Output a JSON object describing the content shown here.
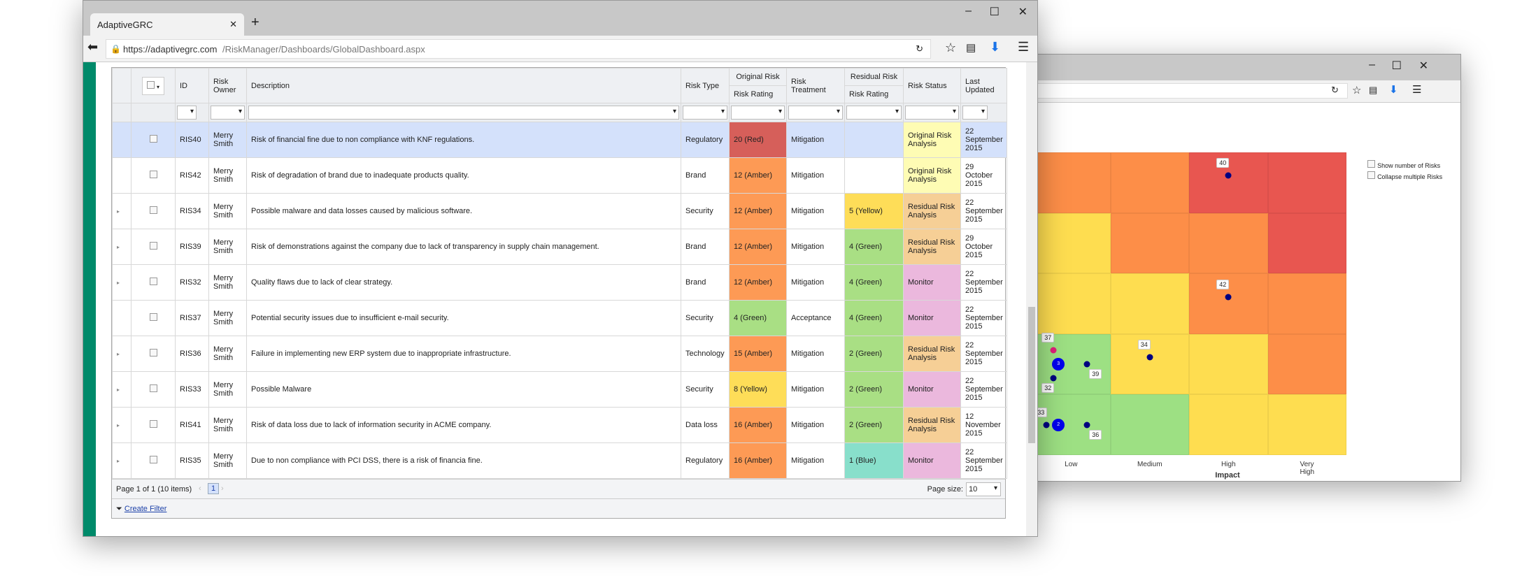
{
  "browser": {
    "tab_title": "AdaptiveGRC",
    "url_host": "https://adaptivegrc.com",
    "url_path": "/RiskManager/Dashboards/GlobalDashboard.aspx"
  },
  "table": {
    "headers": {
      "id": "ID",
      "owner": "Risk Owner",
      "description": "Description",
      "type": "Risk Type",
      "original_group": "Original Risk",
      "original_rating": "Risk Rating",
      "treatment": "Risk Treatment",
      "residual_group": "Residual Risk",
      "residual_rating": "Risk Rating",
      "status": "Risk Status",
      "updated": "Last Updated"
    },
    "rows": [
      {
        "id": "RIS40",
        "owner": "Merry Smith",
        "description": "Risk of financial fine due to non compliance with KNF regulations.",
        "type": "Regulatory",
        "orig": "20 (Red)",
        "orig_color": "#d65f5a",
        "treatment": "Mitigation",
        "resid": "",
        "resid_color": "",
        "status": "Original Risk Analysis",
        "status_color": "#fefcb4",
        "updated": "22 September 2015",
        "expandable": false,
        "selected": true
      },
      {
        "id": "RIS42",
        "owner": "Merry Smith",
        "description": "Risk of degradation of brand due to inadequate products quality.",
        "type": "Brand",
        "orig": "12 (Amber)",
        "orig_color": "#fd9a55",
        "treatment": "Mitigation",
        "resid": "",
        "resid_color": "",
        "status": "Original Risk Analysis",
        "status_color": "#fefcb4",
        "updated": "29 October 2015",
        "expandable": false
      },
      {
        "id": "RIS34",
        "owner": "Merry Smith",
        "description": "Possible malware and data losses caused by malicious software.",
        "type": "Security",
        "orig": "12 (Amber)",
        "orig_color": "#fd9a55",
        "treatment": "Mitigation",
        "resid": "5 (Yellow)",
        "resid_color": "#fedd58",
        "status": "Residual Risk Analysis",
        "status_color": "#f6cf96",
        "updated": "22 September 2015",
        "expandable": true
      },
      {
        "id": "RIS39",
        "owner": "Merry Smith",
        "description": "Risk of demonstrations against the company due to lack of transparency in supply chain management.",
        "type": "Brand",
        "orig": "12 (Amber)",
        "orig_color": "#fd9a55",
        "treatment": "Mitigation",
        "resid": "4 (Green)",
        "resid_color": "#a9df84",
        "status": "Residual Risk Analysis",
        "status_color": "#f6cf96",
        "updated": "29 October 2015",
        "expandable": true
      },
      {
        "id": "RIS32",
        "owner": "Merry Smith",
        "description": "Quality flaws due to lack of clear strategy.",
        "type": "Brand",
        "orig": "12 (Amber)",
        "orig_color": "#fd9a55",
        "treatment": "Mitigation",
        "resid": "4 (Green)",
        "resid_color": "#a9df84",
        "status": "Monitor",
        "status_color": "#ebb8dd",
        "updated": "22 September 2015",
        "expandable": true
      },
      {
        "id": "RIS37",
        "owner": "Merry Smith",
        "description": "Potential security issues due to insufficient e-mail security.",
        "type": "Security",
        "orig": "4 (Green)",
        "orig_color": "#a9df84",
        "treatment": "Acceptance",
        "resid": "4 (Green)",
        "resid_color": "#a9df84",
        "status": "Monitor",
        "status_color": "#ebb8dd",
        "updated": "22 September 2015",
        "expandable": false
      },
      {
        "id": "RIS36",
        "owner": "Merry Smith",
        "description": "Failure in implementing new ERP system due to inappropriate infrastructure.",
        "type": "Technology",
        "orig": "15 (Amber)",
        "orig_color": "#fd9a55",
        "treatment": "Mitigation",
        "resid": "2 (Green)",
        "resid_color": "#a9df84",
        "status": "Residual Risk Analysis",
        "status_color": "#f6cf96",
        "updated": "22 September 2015",
        "expandable": true
      },
      {
        "id": "RIS33",
        "owner": "Merry Smith",
        "description": "Possible Malware",
        "type": "Security",
        "orig": "8 (Yellow)",
        "orig_color": "#fedd58",
        "treatment": "Mitigation",
        "resid": "2 (Green)",
        "resid_color": "#a9df84",
        "status": "Monitor",
        "status_color": "#ebb8dd",
        "updated": "22 September 2015",
        "expandable": true
      },
      {
        "id": "RIS41",
        "owner": "Merry Smith",
        "description": "Risk of data loss due to lack of information security in ACME company.",
        "type": "Data loss",
        "orig": "16 (Amber)",
        "orig_color": "#fd9a55",
        "treatment": "Mitigation",
        "resid": "2 (Green)",
        "resid_color": "#a9df84",
        "status": "Residual Risk Analysis",
        "status_color": "#f6cf96",
        "updated": "12 November 2015",
        "expandable": true
      },
      {
        "id": "RIS35",
        "owner": "Merry Smith",
        "description": "Due to non compliance with PCI DSS, there is a risk of financia fine.",
        "type": "Regulatory",
        "orig": "16 (Amber)",
        "orig_color": "#fd9a55",
        "treatment": "Mitigation",
        "resid": "1 (Blue)",
        "resid_color": "#88dfcb",
        "status": "Monitor",
        "status_color": "#ebb8dd",
        "updated": "22 September 2015",
        "expandable": true
      }
    ],
    "pager": {
      "summary": "Page 1 of 1 (10 items)",
      "current_page": "1",
      "page_size_label": "Page size:",
      "page_size": "10"
    },
    "create_filter": "Create Filter"
  },
  "heatmap": {
    "x_axis_title": "Impact",
    "x_categories": [
      "Low",
      "Medium",
      "High",
      "Very High"
    ],
    "cell_colors": [
      [
        "#fd8e48",
        "#fd8e48",
        "#e85650",
        "#e85650"
      ],
      [
        "#fedd50",
        "#fd8e48",
        "#fd8e48",
        "#e85650"
      ],
      [
        "#fedd50",
        "#fedd50",
        "#fd8e48",
        "#fd8e48"
      ],
      [
        "#9de083",
        "#fedd50",
        "#fedd50",
        "#fd8e48"
      ],
      [
        "#9de083",
        "#9de083",
        "#fedd50",
        "#fedd50"
      ]
    ],
    "options": [
      "Show number of Risks",
      "Collapse multiple Risks"
    ],
    "points": [
      {
        "label": "40",
        "row": 0,
        "col": 2
      },
      {
        "label": "42",
        "row": 2,
        "col": 2
      },
      {
        "label": "34",
        "row": 3,
        "col": 1
      },
      {
        "label": "37",
        "row": 3,
        "col": 0,
        "color": "#e0207a"
      },
      {
        "label": "3",
        "row": 3,
        "col": 0,
        "cluster": true
      },
      {
        "label": "39",
        "row": 3,
        "col": 0
      },
      {
        "label": "32",
        "row": 3,
        "col": 0
      },
      {
        "label": "33",
        "row": 4,
        "col": 0
      },
      {
        "label": "2",
        "row": 4,
        "col": 0,
        "cluster": true
      },
      {
        "label": "36",
        "row": 4,
        "col": 0
      }
    ]
  }
}
